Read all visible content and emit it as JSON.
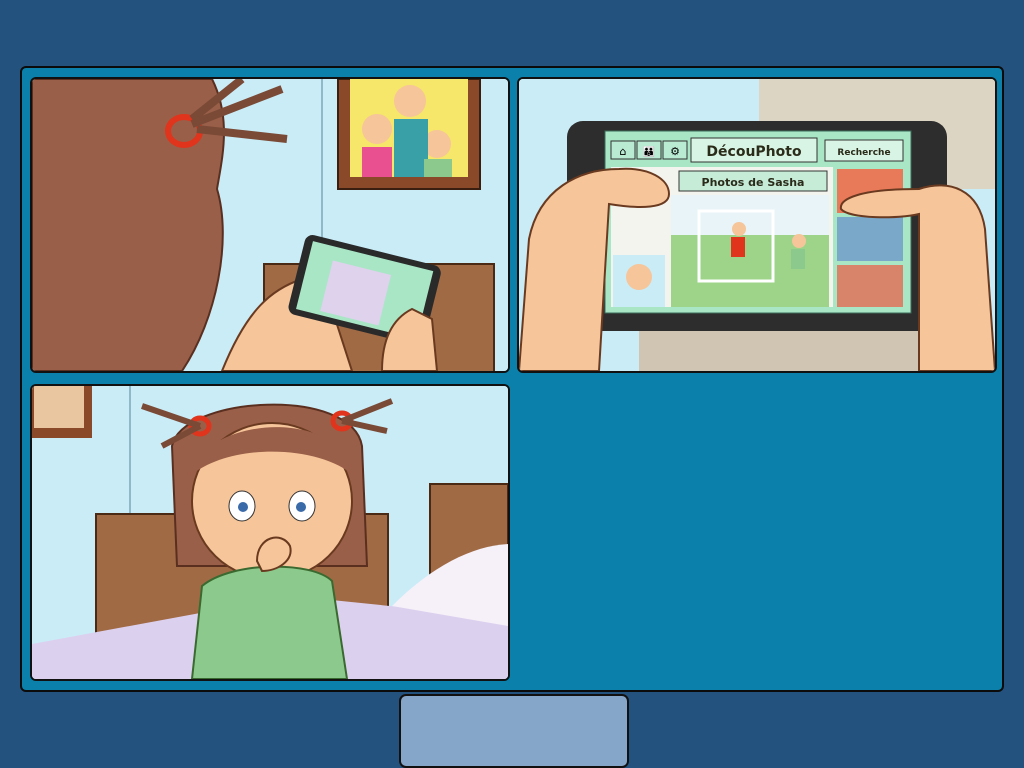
{
  "colors": {
    "background": "#24527f",
    "frame": "#0a80aa",
    "next_button": "#86a6c9",
    "wall": "#c9ecf7",
    "app_green": "#a8e6c6"
  },
  "panels": [
    {
      "scene": "girl looking at phone in bedroom"
    },
    {
      "scene": "hands holding phone showing app",
      "app": {
        "title": "DécouPhoto",
        "search_label": "Recherche",
        "album_title": "Photos de Sasha",
        "icons": [
          "home-icon",
          "people-icon",
          "gear-icon"
        ]
      }
    },
    {
      "scene": "surprised girl with hand on mouth"
    }
  ],
  "next_button": {
    "label": ""
  }
}
